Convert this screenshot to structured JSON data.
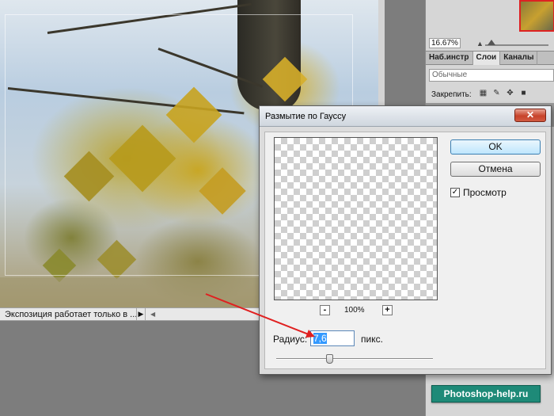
{
  "document": {
    "status_text": "Экспозиция работает только в ..."
  },
  "navigator": {
    "zoom": "16.67%"
  },
  "panel_tabs": [
    {
      "label": "Наб.инстр"
    },
    {
      "label": "Слои"
    },
    {
      "label": "Каналы"
    }
  ],
  "layers": {
    "blend_mode": "Обычные",
    "lock_label": "Закрепить:"
  },
  "dialog": {
    "title": "Размытие по Гауссу",
    "close_glyph": "✕",
    "ok_label": "OK",
    "cancel_label": "Отмена",
    "preview_label": "Просмотр",
    "preview_checked": "✓",
    "zoom_minus": "-",
    "zoom_plus": "+",
    "zoom_value": "100%",
    "radius_label": "Радиус:",
    "radius_value": "7,6",
    "units_label": "пикс."
  },
  "watermark": "Photoshop-help.ru",
  "icons": {
    "status_arrow": "play-right-icon",
    "lock_transparency": "checker-icon",
    "lock_paint": "brush-icon",
    "lock_move": "move-icon",
    "lock_all": "lock-icon"
  },
  "colors": {
    "annotation_arrow": "#e02020",
    "watermark_bg": "#1e8a78",
    "close_button": "#c7432b"
  }
}
